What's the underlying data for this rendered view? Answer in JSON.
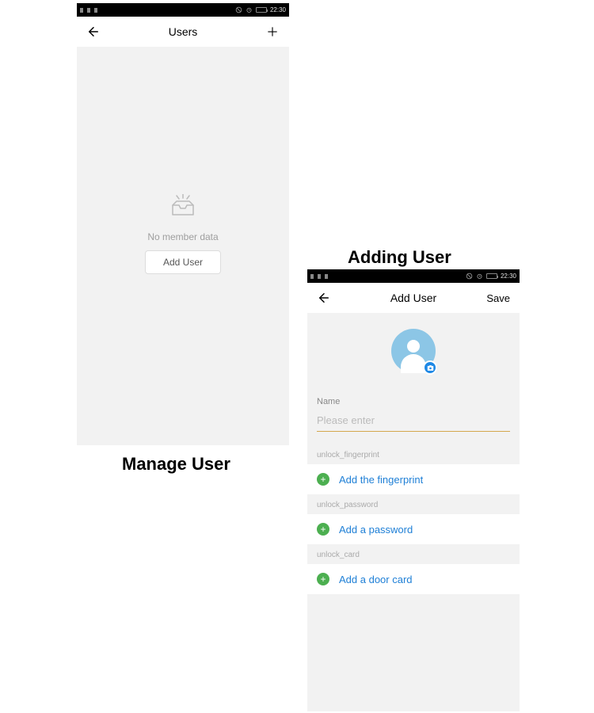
{
  "status": {
    "time": "22:30"
  },
  "manage": {
    "title": "Users",
    "empty_text": "No member data",
    "add_button": "Add User",
    "caption": "Manage User"
  },
  "add": {
    "title": "Add User",
    "save": "Save",
    "name_label": "Name",
    "name_placeholder": "Please enter",
    "fp_group": "unlock_fingerprint",
    "fp_label": "Add the fingerprint",
    "pw_group": "unlock_password",
    "pw_label": "Add a password",
    "card_group": "unlock_card",
    "card_label": "Add a door card",
    "caption": "Adding User"
  }
}
